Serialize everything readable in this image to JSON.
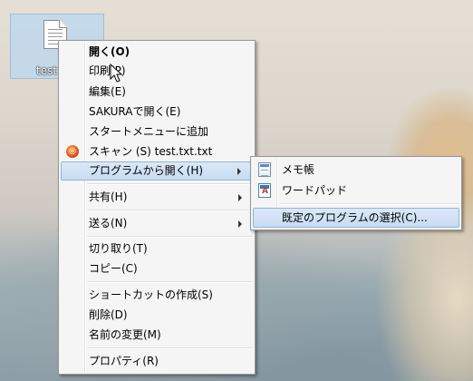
{
  "desktop": {
    "file_icon": {
      "icon": "text-file-icon",
      "label": "test"
    }
  },
  "context_menu": {
    "items": [
      {
        "id": "open",
        "label": "開く(O)",
        "bold": true
      },
      {
        "id": "print",
        "label": "印刷(P)"
      },
      {
        "id": "edit",
        "label": "編集(E)"
      },
      {
        "id": "open-sakura",
        "label": "SAKURAで開く(E)"
      },
      {
        "id": "add-start-menu",
        "label": "スタートメニューに追加"
      },
      {
        "id": "scan",
        "label": "スキャン (S) test.txt.txt",
        "icon": "scan-icon"
      },
      {
        "id": "open-with",
        "label": "プログラムから開く(H)",
        "submenu": true,
        "highlighted": true
      },
      {
        "id": "share",
        "label": "共有(H)",
        "submenu": true
      },
      {
        "id": "send-to",
        "label": "送る(N)",
        "submenu": true
      },
      {
        "id": "cut",
        "label": "切り取り(T)"
      },
      {
        "id": "copy",
        "label": "コピー(C)"
      },
      {
        "id": "create-shortcut",
        "label": "ショートカットの作成(S)"
      },
      {
        "id": "delete",
        "label": "削除(D)"
      },
      {
        "id": "rename",
        "label": "名前の変更(M)"
      },
      {
        "id": "properties",
        "label": "プロパティ(R)"
      }
    ]
  },
  "open_with_submenu": {
    "items": [
      {
        "id": "notepad",
        "label": "メモ帳",
        "icon": "notepad-icon"
      },
      {
        "id": "wordpad",
        "label": "ワードパッド",
        "icon": "wordpad-icon"
      },
      {
        "id": "choose-default",
        "label": "既定のプログラムの選択(C)...",
        "highlighted": true
      }
    ]
  },
  "colors": {
    "menu_bg": "#f5f5f5",
    "highlight_bg": "#c8dcf3",
    "highlight_border": "#91b4e1",
    "selection_bg": "#b9d7f0"
  }
}
